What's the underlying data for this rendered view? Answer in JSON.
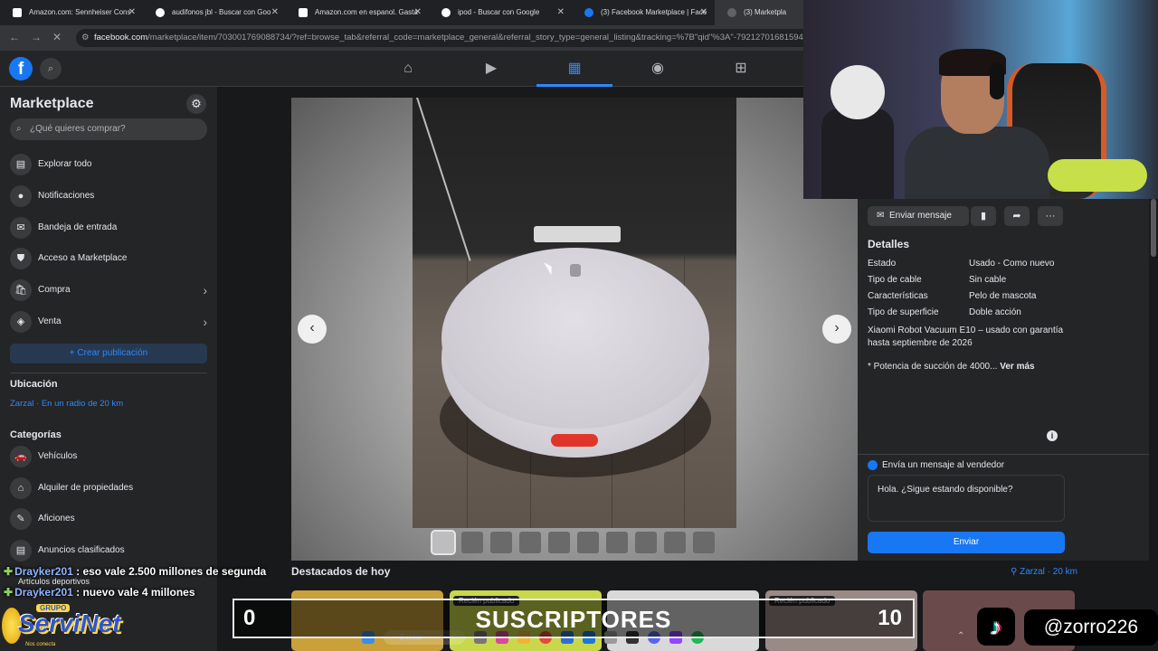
{
  "browser": {
    "tabs": [
      {
        "title": "Amazon.com: Sennheiser Cons",
        "favicon_color": "#ffffff",
        "active": false
      },
      {
        "title": "audifonos jbl - Buscar con Goo",
        "favicon_color": "#ffffff",
        "active": false
      },
      {
        "title": "Amazon.com en espanol. Gasta",
        "favicon_color": "#ffffff",
        "active": false
      },
      {
        "title": "ipod - Buscar con Google",
        "favicon_color": "#ffffff",
        "active": false
      },
      {
        "title": "(3) Facebook Marketplace | Face",
        "favicon_color": "#1877f2",
        "active": false
      },
      {
        "title": "(3) Marketpla",
        "favicon_color": "#1877f2",
        "active": true
      }
    ],
    "url_domain": "facebook.com",
    "url_rest": "/marketplace/item/703001769088734/?ref=browse_tab&referral_code=marketplace_general&referral_story_type=general_listing&tracking=%7B\"qid\"%3A\"-79212701681594105"
  },
  "fb_nav": {
    "logo": "f",
    "items": [
      {
        "name": "home",
        "icon": "⌂"
      },
      {
        "name": "watch",
        "icon": "▶"
      },
      {
        "name": "marketplace",
        "icon": "▦"
      },
      {
        "name": "groups",
        "icon": "◉"
      },
      {
        "name": "gaming",
        "icon": "⊞"
      }
    ]
  },
  "sidebar": {
    "title": "Marketplace",
    "search_placeholder": "¿Qué quieres comprar?",
    "items": [
      {
        "label": "Explorar todo",
        "icon": "▤"
      },
      {
        "label": "Notificaciones",
        "icon": "●"
      },
      {
        "label": "Bandeja de entrada",
        "icon": "✉"
      },
      {
        "label": "Acceso a Marketplace",
        "icon": "⛊"
      },
      {
        "label": "Compra",
        "icon": "🛍"
      },
      {
        "label": "Venta",
        "icon": "◈"
      }
    ],
    "create_button": "+ Crear publicación",
    "location_heading": "Ubicación",
    "location_value": "Zarzal · En un radio de 20 km",
    "categories_heading": "Categorías",
    "categories": [
      {
        "label": "Vehículos",
        "icon": "🚗"
      },
      {
        "label": "Alquiler de propiedades",
        "icon": "⌂"
      },
      {
        "label": "Aficiones",
        "icon": "✎"
      },
      {
        "label": "Anuncios clasificados",
        "icon": "▤"
      }
    ]
  },
  "viewer": {
    "prev_icon": "‹",
    "next_icon": "›",
    "thumbnail_count": 10,
    "selected_thumbnail": 0
  },
  "details": {
    "message_button": "Enviar mensaje",
    "title": "Detalles",
    "rows": [
      {
        "key": "Estado",
        "value": "Usado - Como nuevo"
      },
      {
        "key": "Tipo de cable",
        "value": "Sin cable"
      },
      {
        "key": "Características",
        "value": "Pelo de mascota"
      },
      {
        "key": "Tipo de superficie",
        "value": "Doble acción"
      }
    ],
    "description": "Xiaomi Robot Vacuum E10 – usado con garantía hasta septiembre de 2026",
    "description_more": "* Potencia de succión de 4000...",
    "see_more": "Ver más",
    "send_label": "Envía un mensaje al vendedor",
    "send_input_value": "Hola. ¿Sigue estando disponible?",
    "send_button": "Enviar"
  },
  "featured": {
    "title": "Destacados de hoy",
    "location": "Zarzal · 20 km",
    "cards": [
      {
        "badge": "",
        "color": "#c9a03a"
      },
      {
        "badge": "Recién publicado",
        "color": "#c8d84a"
      },
      {
        "badge": "",
        "color": "#d9d9d9"
      },
      {
        "badge": "Recién publicado",
        "color": "#9a8a86"
      },
      {
        "badge": "",
        "color": "#6a4a4a"
      }
    ]
  },
  "stream": {
    "chat": [
      {
        "user": "Drayker201",
        "text": " : eso vale 2.500 millones de segunda"
      },
      {
        "user": "Drayker201",
        "text": " : nuevo vale 4 millones"
      }
    ],
    "chat_sub": "Artículos deportivos",
    "logo_small": "GRUPO",
    "logo_big": "ServiNet",
    "logo_tag": "Nos conecta",
    "subs_left": "0",
    "subs_label": "SUSCRIPTORES",
    "subs_right": "10",
    "handle": "@zorro226",
    "taskbar_search": "Buscar"
  }
}
